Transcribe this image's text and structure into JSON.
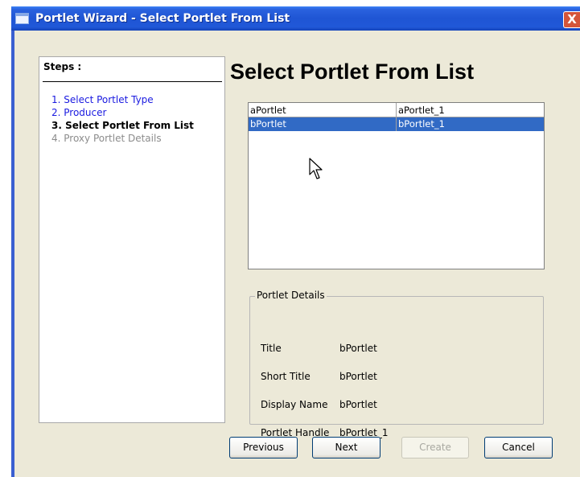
{
  "window": {
    "title": "Portlet Wizard - Select Portlet From List",
    "close_glyph": "X"
  },
  "steps": {
    "heading": "Steps :",
    "items": [
      {
        "label": "1. Select Portlet Type",
        "state": "done"
      },
      {
        "label": "2. Producer",
        "state": "done"
      },
      {
        "label": "3. Select Portlet From List",
        "state": "current"
      },
      {
        "label": "4. Proxy Portlet Details",
        "state": "future"
      }
    ]
  },
  "page": {
    "title": "Select Portlet From List"
  },
  "portlet_list": {
    "rows": [
      {
        "name": "aPortlet",
        "handle": "aPortlet_1",
        "selected": false
      },
      {
        "name": "bPortlet",
        "handle": "bPortlet_1",
        "selected": true
      }
    ]
  },
  "details": {
    "legend": "Portlet Details",
    "fields": [
      {
        "label": "Title",
        "value": "bPortlet"
      },
      {
        "label": "Short Title",
        "value": "bPortlet"
      },
      {
        "label": "Display Name",
        "value": "bPortlet"
      },
      {
        "label": "Portlet Handle",
        "value": "bPortlet_1"
      }
    ]
  },
  "buttons": {
    "previous": "Previous",
    "next": "Next",
    "create": "Create",
    "cancel": "Cancel"
  },
  "colors": {
    "selection": "#316ac5",
    "link_blue": "#1a1ae0",
    "dialog_bg": "#ece9d8"
  },
  "icons": {
    "window": "window-icon",
    "close": "close-icon",
    "pointer": "mouse-pointer-icon"
  }
}
